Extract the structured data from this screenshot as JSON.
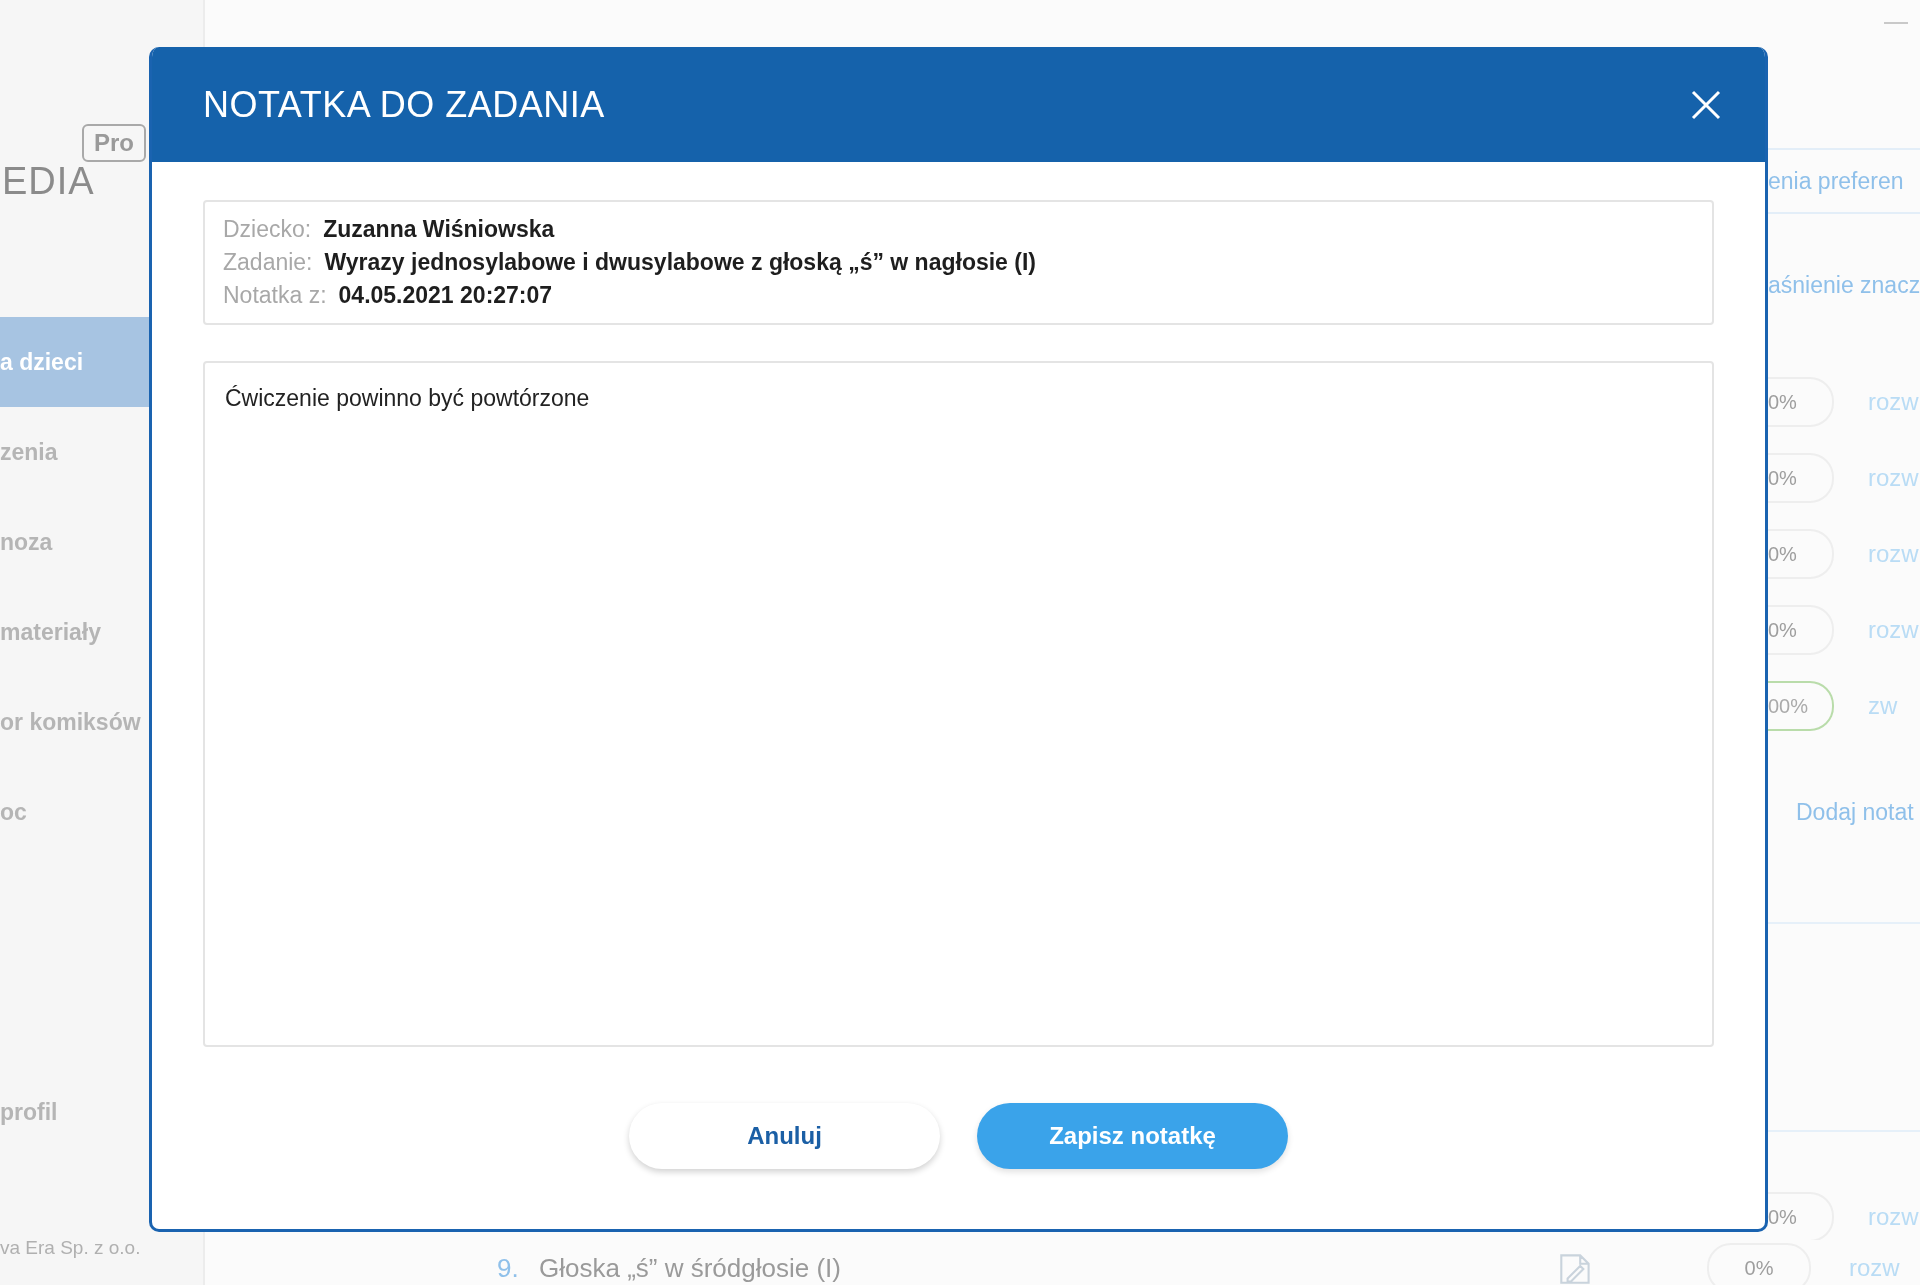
{
  "sidebar": {
    "logo_text": "EDIA",
    "logo_badge": "Pro",
    "items": [
      {
        "label": "a dzieci",
        "selected": true
      },
      {
        "label": "zenia",
        "selected": false
      },
      {
        "label": "noza",
        "selected": false
      },
      {
        "label": "materiały",
        "selected": false
      },
      {
        "label": "or komiksów",
        "selected": false
      },
      {
        "label": "oc",
        "selected": false
      }
    ],
    "profile": "profil",
    "footer": "va Era Sp. z o.o."
  },
  "background": {
    "links": [
      "enia preferen",
      "aśnienie znacz"
    ],
    "rows": [
      {
        "percent": "0%",
        "action": "rozw",
        "complete": false
      },
      {
        "percent": "0%",
        "action": "rozw",
        "complete": false
      },
      {
        "percent": "0%",
        "action": "rozw",
        "complete": false
      },
      {
        "percent": "0%",
        "action": "rozw",
        "complete": false
      },
      {
        "percent": "00%",
        "action": "zw",
        "complete": true
      }
    ],
    "add_note": "Dodaj notat",
    "lower_row": {
      "percent": "0%",
      "action": "rozw",
      "complete": false
    },
    "task": {
      "number": "9.",
      "title": "Głoska „ś” w śródgłosie (I)",
      "percent": "0%",
      "action": "rozw",
      "complete": false
    }
  },
  "dialog": {
    "title": "NOTATKA DO ZADANIA",
    "info": [
      {
        "label": "Dziecko:",
        "value": "Zuzanna Wiśniowska"
      },
      {
        "label": "Zadanie:",
        "value": "Wyrazy jednosylabowe i dwusylabowe z głoską „ś” w nagłosie (I)"
      },
      {
        "label": "Notatka z:",
        "value": "04.05.2021 20:27:07"
      }
    ],
    "note": {
      "value": "Ćwiczenie powinno być powtórzone"
    },
    "buttons": [
      {
        "label": "Anuluj",
        "kind": "secondary"
      },
      {
        "label": "Zapisz notatkę",
        "kind": "primary"
      }
    ]
  }
}
